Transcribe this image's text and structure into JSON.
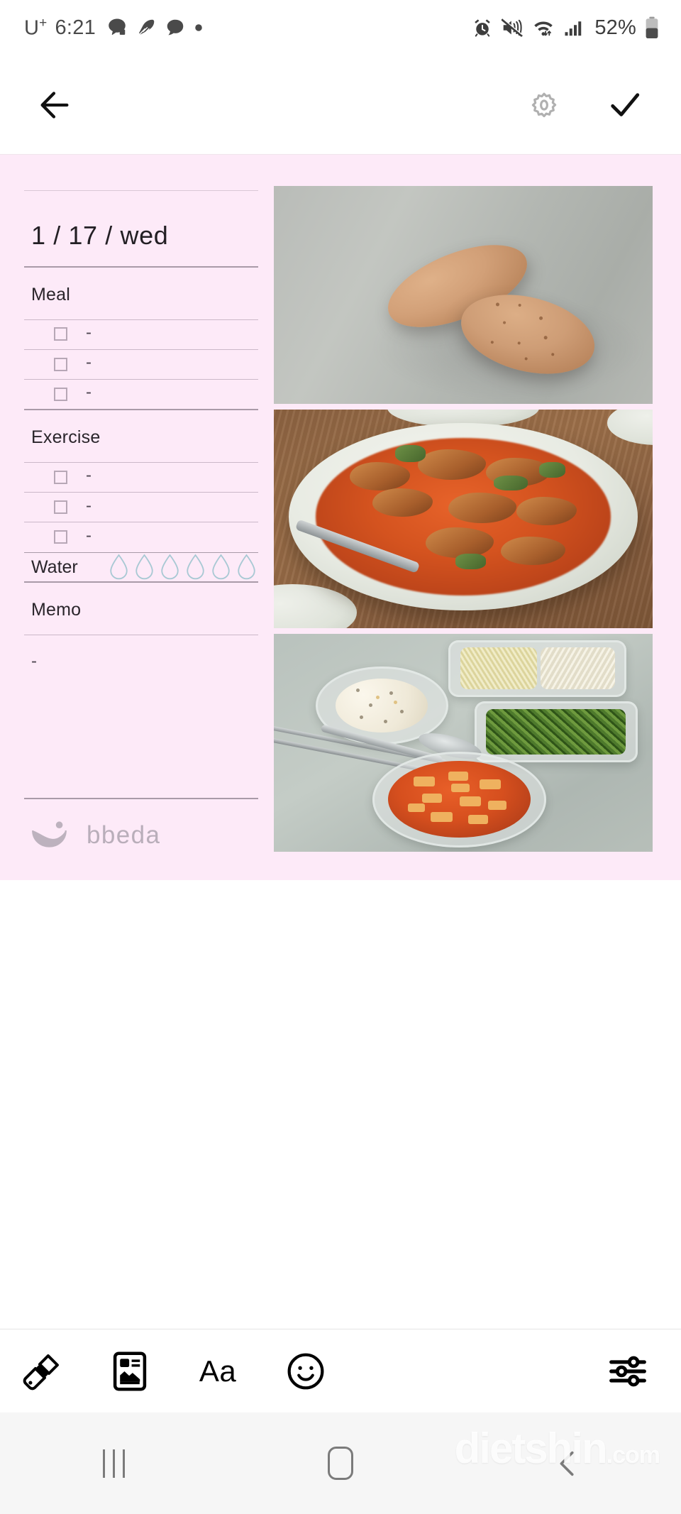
{
  "status_bar": {
    "carrier": "U",
    "carrier_sup": "+",
    "time": "6:21",
    "left_icons": [
      "kakao-icon",
      "feather-icon",
      "speech-bubble-icon",
      "dot-icon"
    ],
    "right_icons": [
      "alarm-icon",
      "mute-icon",
      "wifi-icon",
      "signal-icon"
    ],
    "battery_percent": "52%"
  },
  "app_bar": {
    "back_icon": "back-arrow-icon",
    "settings_icon": "gear-icon",
    "confirm_icon": "check-icon"
  },
  "diary": {
    "date": "1 / 17 / wed",
    "sections": [
      {
        "title": "Meal",
        "rows": [
          {
            "checked": false,
            "value": "-"
          },
          {
            "checked": false,
            "value": "-"
          },
          {
            "checked": false,
            "value": "-"
          }
        ]
      },
      {
        "title": "Exercise",
        "rows": [
          {
            "checked": false,
            "value": "-"
          },
          {
            "checked": false,
            "value": "-"
          },
          {
            "checked": false,
            "value": "-"
          }
        ]
      }
    ],
    "water": {
      "label": "Water",
      "total": 6,
      "filled": 0,
      "drop_color": "#a9c9d4"
    },
    "memo": {
      "label": "Memo",
      "value": "-"
    },
    "brand": {
      "name": "bbeda",
      "logo_icon": "bbeda-bowl-logo-icon",
      "color": "#b9aeba"
    },
    "background_color": "#fdeaf8"
  },
  "photos": [
    {
      "alt": "two brown eggs on a gray cloth",
      "name": "photo-eggs"
    },
    {
      "alt": "spicy braised dish on a white plate on a wooden table",
      "name": "photo-braised-dish"
    },
    {
      "alt": "lunch boxes with rice, bean sprouts, seasoned greens and kimchi stew",
      "name": "photo-lunch-boxes"
    }
  ],
  "toolbar": {
    "items": [
      {
        "icon": "paint-brush-icon",
        "name": "brush-tool"
      },
      {
        "icon": "template-card-icon",
        "name": "template-tool"
      },
      {
        "icon": "text-format-icon",
        "label": "Aa",
        "name": "text-tool"
      },
      {
        "icon": "smiley-face-icon",
        "name": "sticker-tool"
      }
    ],
    "adjust_icon": "sliders-icon"
  },
  "nav_bar": {
    "recents_icon": "recents-icon",
    "home_icon": "home-icon",
    "back_icon": "nav-back-icon",
    "watermark": "dietshin",
    "watermark_suffix": ".com"
  }
}
